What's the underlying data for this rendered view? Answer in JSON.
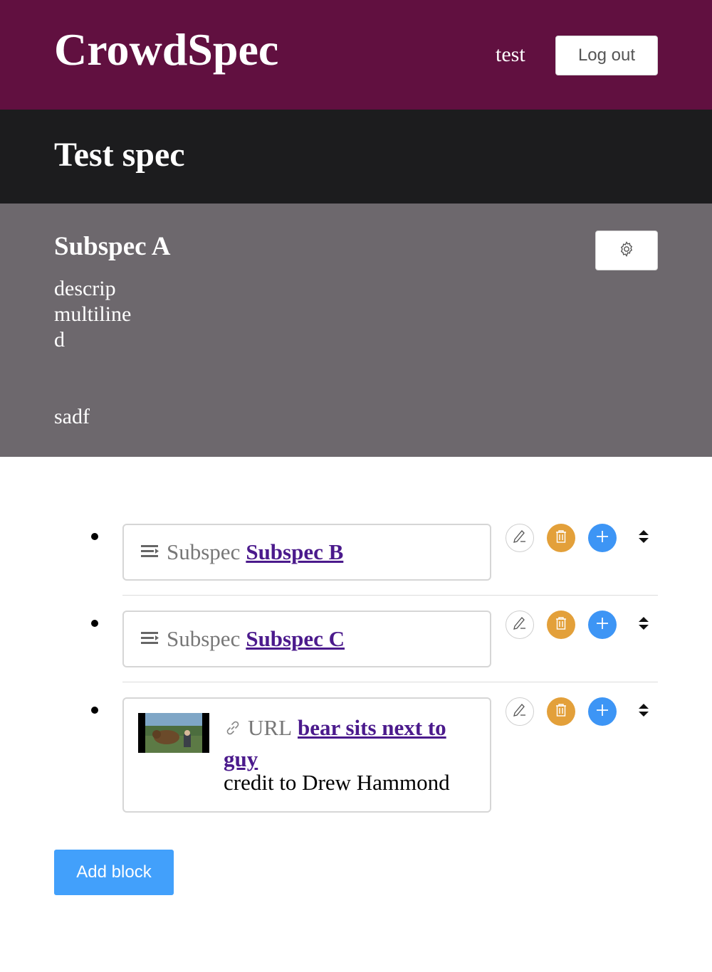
{
  "header": {
    "brand": "CrowdSpec",
    "username": "test",
    "logout_label": "Log out"
  },
  "spec": {
    "title": "Test spec"
  },
  "subspec": {
    "title": "Subspec A",
    "description": "descrip\nmultiline\nd\n\n\nsadf"
  },
  "blocks": [
    {
      "kind": "Subspec",
      "link_text": "Subspec B",
      "icon": "subspec-lines-icon"
    },
    {
      "kind": "Subspec",
      "link_text": "Subspec C",
      "icon": "subspec-lines-icon"
    },
    {
      "kind": "URL",
      "link_text": "bear sits next to guy",
      "credit": "credit to Drew Hammond",
      "icon": "link-icon"
    }
  ],
  "actions": {
    "edit_icon": "pencil-icon",
    "delete_icon": "trash-icon",
    "add_icon": "plus-icon",
    "move_icon": "sort-arrows-icon"
  },
  "footer": {
    "add_block_label": "Add block"
  },
  "colors": {
    "header_bg": "#611040",
    "spec_bar_bg": "#1c1c1e",
    "subspec_bg": "#6d686d",
    "delete": "#e3a03a",
    "add": "#3d95f5",
    "link": "#4b1a8c"
  }
}
